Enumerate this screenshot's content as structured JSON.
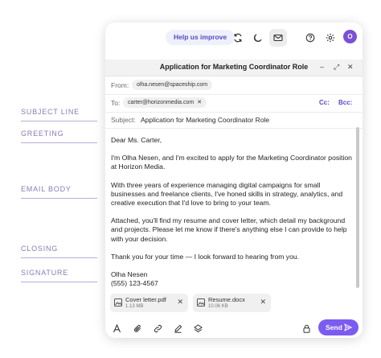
{
  "annotations": {
    "subject_line": "SUBJECT LINE",
    "greeting": "GREETING",
    "email_body": "EMAIL BODY",
    "closing": "CLOSING",
    "signature": "SIGNATURE"
  },
  "toolbar": {
    "help_label": "Help us improve",
    "avatar_initial": "O",
    "icons": [
      "refresh-icon",
      "moon-icon",
      "mail-icon",
      "help-circle-icon",
      "gear-icon"
    ]
  },
  "compose": {
    "title": "Application for Marketing Coordinator Role",
    "window_controls": {
      "minimize": "–",
      "expand": "⤢",
      "close": "✕"
    },
    "from_label": "From:",
    "from_value": "olha.nesen@spaceship.com",
    "to_label": "To:",
    "to_value": "carter@horizonmedia.com",
    "cc_label": "Cc:",
    "bcc_label": "Bcc:",
    "subject_label": "Subject:",
    "subject_value": "Application for Marketing Coordinator Role"
  },
  "body": {
    "greeting": "Dear Ms. Carter,",
    "p1": "I'm Olha Nesen, and I'm excited to apply for the Marketing Coordinator position at Horizon Media.",
    "p2": "With three years of experience managing digital campaigns for small businesses and freelance clients, I've honed skills in strategy, analytics, and creative execution that I'd love to bring to your team.",
    "p3": "Attached, you'll find my resume and cover letter, which detail my background and projects. Please let me know if there's anything else I can provide to help with your decision.",
    "closing": "Thank you for your time — I look forward to hearing from you.",
    "sig_name": "Olha Nesen",
    "sig_phone": "(555) 123-4567"
  },
  "attachments": [
    {
      "name": "Cover letter.pdf",
      "size": "1.13 MB"
    },
    {
      "name": "Resume.docx",
      "size": "10.06 KB"
    }
  ],
  "send_label": "Send",
  "colors": {
    "accent": "#5848c9",
    "send": "#7b5cf0",
    "annotation": "#8b79b8"
  }
}
